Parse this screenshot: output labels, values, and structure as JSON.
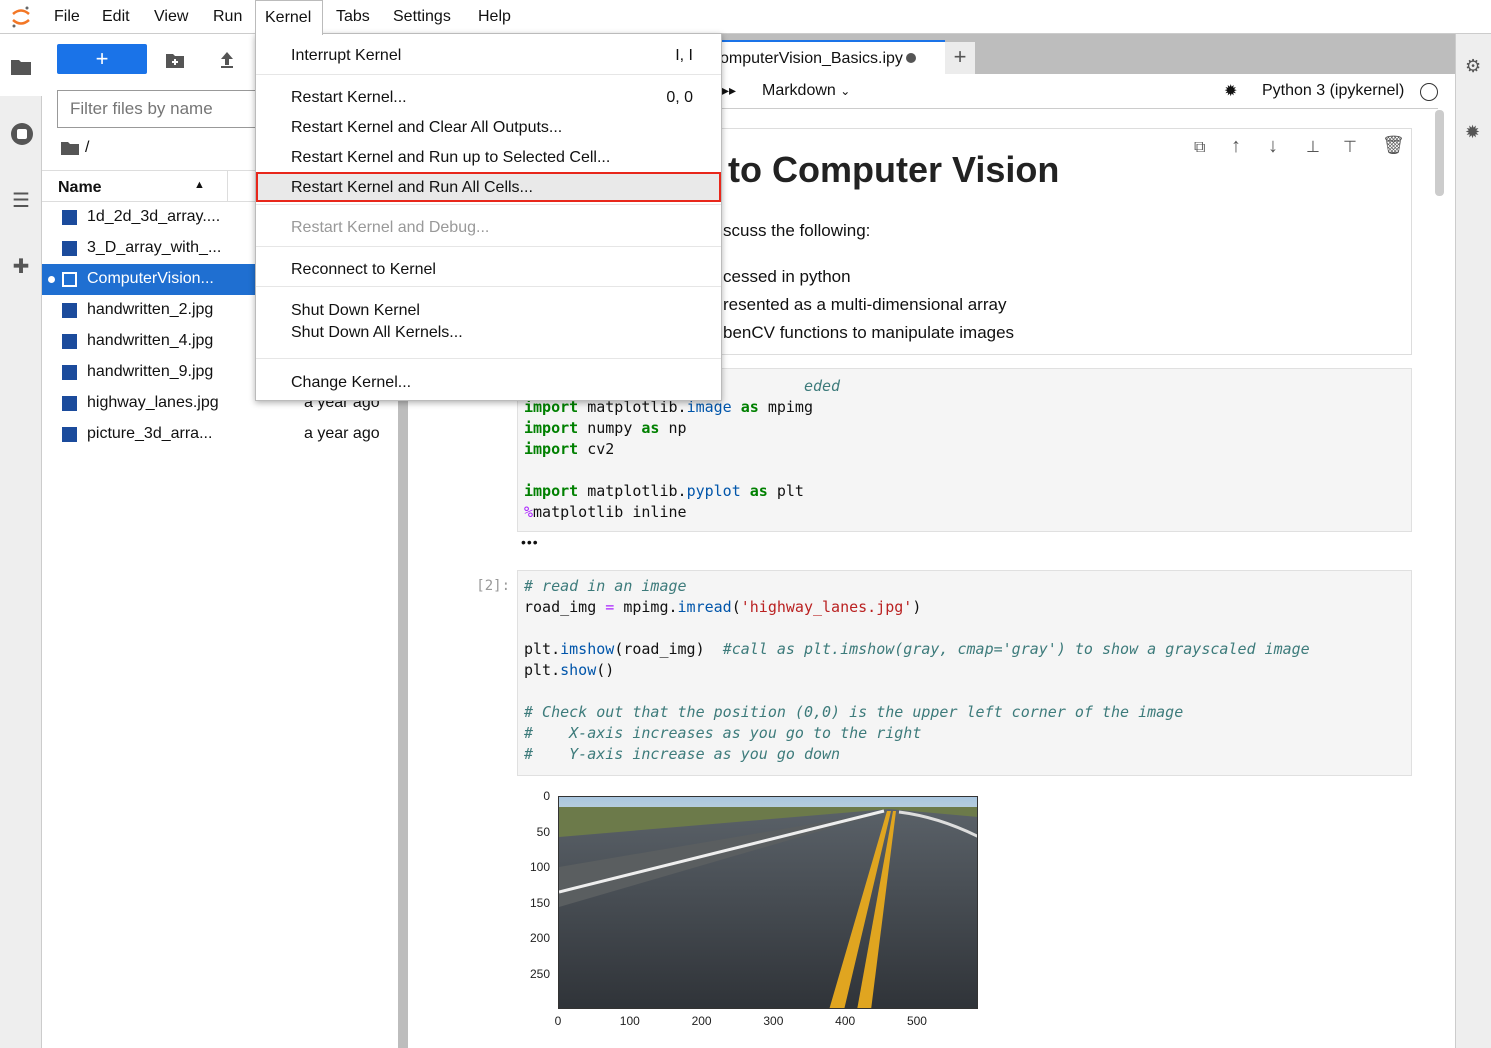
{
  "menubar": {
    "items": [
      "File",
      "Edit",
      "View",
      "Run",
      "Kernel",
      "Tabs",
      "Settings",
      "Help"
    ]
  },
  "kernel_menu": {
    "items": [
      {
        "label": "Interrupt Kernel",
        "shortcut": "I, I"
      },
      {
        "label": "Restart Kernel...",
        "shortcut": "0, 0"
      },
      {
        "label": "Restart Kernel and Clear All Outputs..."
      },
      {
        "label": "Restart Kernel and Run up to Selected Cell..."
      },
      {
        "label": "Restart Kernel and Run All Cells...",
        "highlighted": true
      },
      {
        "label": "Restart Kernel and Debug...",
        "disabled": true
      },
      {
        "label": "Reconnect to Kernel"
      },
      {
        "label": "Shut Down Kernel"
      },
      {
        "label": "Shut Down All Kernels..."
      },
      {
        "label": "Change Kernel..."
      }
    ]
  },
  "filebrowser": {
    "new_label": "+",
    "filter_placeholder": "Filter files by name",
    "path": "/",
    "column_name": "Name",
    "files": [
      {
        "name": "1d_2d_3d_array....",
        "date": ""
      },
      {
        "name": "3_D_array_with_...",
        "date": ""
      },
      {
        "name": "ComputerVision...",
        "date": "",
        "selected": true
      },
      {
        "name": "handwritten_2.jpg",
        "date": ""
      },
      {
        "name": "handwritten_4.jpg",
        "date": ""
      },
      {
        "name": "handwritten_9.jpg",
        "date": ""
      },
      {
        "name": "highway_lanes.jpg",
        "date": "a year ago"
      },
      {
        "name": "picture_3d_arra...",
        "date": "a year ago"
      }
    ]
  },
  "notebook": {
    "tab_title": "omputerVision_Basics.ipy",
    "cell_type": "Markdown",
    "kernel_name": "Python 3 (ipykernel)",
    "md": {
      "heading": "to Computer Vision",
      "intro": "scuss the following:",
      "bullets": [
        "cessed in python",
        "resented as a multi-dimensional array",
        "benCV functions to manipulate images"
      ]
    },
    "cell1_prompt": "",
    "cell2_prompt": "[2]:",
    "ellipsis": "•••"
  },
  "plot": {
    "yticks": [
      "0",
      "50",
      "100",
      "150",
      "200",
      "250"
    ],
    "xticks": [
      "0",
      "100",
      "200",
      "300",
      "400",
      "500"
    ]
  },
  "colors": {
    "accent": "#1a73e8",
    "highlight_border": "#e8271b"
  }
}
